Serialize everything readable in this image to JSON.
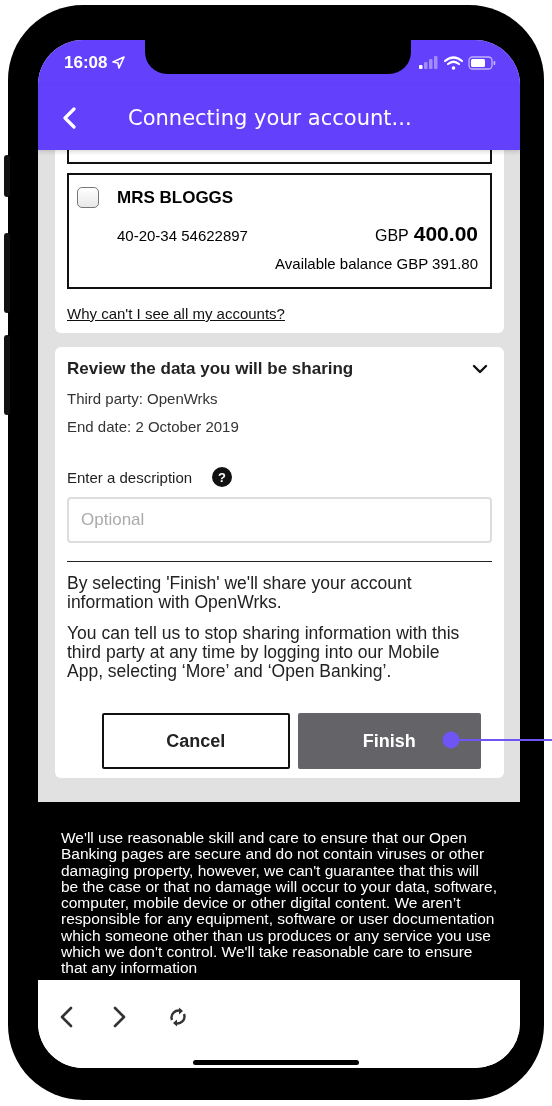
{
  "status_bar": {
    "time": "16:08"
  },
  "header": {
    "title": "Connecting your account..."
  },
  "accounts": [
    {
      "name": "MRS BLOGGS",
      "checked": false,
      "number": "40-20-34 54622897",
      "currency": "GBP",
      "amount": "400.00",
      "available": "Available balance GBP 391.80"
    }
  ],
  "accounts_link": "Why can't I see all my accounts?",
  "review": {
    "title": "Review the data you will be sharing",
    "expanded": true,
    "third_party": "Third party: OpenWrks",
    "end_date": "End date: 2 October 2019",
    "description_label": "Enter a description",
    "help": "?",
    "description_placeholder": "Optional",
    "consent_text": [
      "By selecting 'Finish' we'll share your account information with OpenWrks.",
      "You can tell us to stop sharing information with this third party at any time by logging into our Mobile App, selecting ‘More’ and ‘Open Banking’."
    ],
    "buttons": [
      {
        "label": "Cancel",
        "kind": "secondary"
      },
      {
        "label": "Finish",
        "kind": "primary"
      }
    ]
  },
  "disclaimer": "We'll use reasonable skill and care to ensure that our Open Banking pages are secure and do not contain viruses or other damaging property, however, we can't guarantee that this will be the case or that no damage will occur to your data, software, computer, mobile device or other digital content. We aren’t responsible for any equipment, software or user documentation which someone other than us produces or any service you use which we don't control. We'll take reasonable care to ensure that any information"
}
